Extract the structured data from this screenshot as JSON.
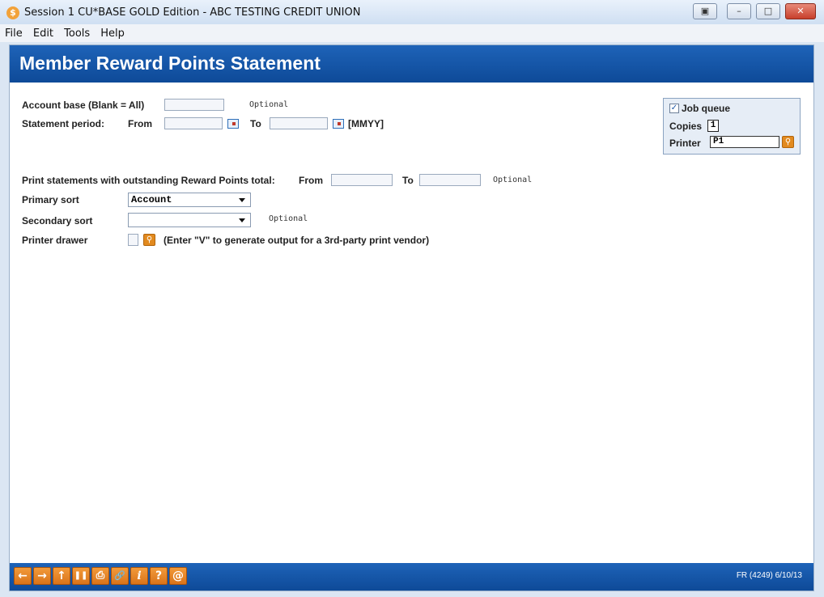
{
  "window": {
    "title": "Session 1 CU*BASE GOLD Edition - ABC TESTING CREDIT UNION",
    "buttons": [
      "restore",
      "minimize",
      "maximize",
      "close"
    ]
  },
  "menu": [
    "File",
    "Edit",
    "Tools",
    "Help"
  ],
  "header": {
    "title": "Member Reward Points Statement"
  },
  "form": {
    "account_base_label": "Account base (Blank = All)",
    "account_base_value": "",
    "account_base_hint": "Optional",
    "statement_period_label": "Statement period:",
    "from_label": "From",
    "from_value": "",
    "to_label": "To",
    "to_value": "",
    "date_format": "[MMYY]",
    "outstanding_label": "Print statements with outstanding Reward Points total:",
    "outstanding_from_label": "From",
    "outstanding_from_value": "",
    "outstanding_to_label": "To",
    "outstanding_to_value": "",
    "outstanding_hint": "Optional",
    "primary_sort_label": "Primary sort",
    "primary_sort_value": "Account",
    "secondary_sort_label": "Secondary sort",
    "secondary_sort_value": "",
    "secondary_sort_hint": "Optional",
    "printer_drawer_label": "Printer drawer",
    "printer_drawer_value": "",
    "printer_drawer_note": "(Enter \"V\" to generate output for a 3rd-party print vendor)"
  },
  "job": {
    "job_queue_label": "Job queue",
    "job_queue_checked": true,
    "copies_label": "Copies",
    "copies_value": "1",
    "printer_label": "Printer",
    "printer_value": "P1"
  },
  "toolbar": {
    "icons": [
      "back-arrow-icon",
      "forward-arrow-icon",
      "up-arrow-icon",
      "pause-icon",
      "print-icon",
      "link-icon",
      "info-icon",
      "help-icon",
      "email-icon"
    ],
    "glyphs": [
      "←",
      "→",
      "↑",
      "❚❚",
      "⎙",
      "🔗",
      "i",
      "?",
      "@"
    ],
    "footer_code": "FR (4249) 6/10/13"
  },
  "colors": {
    "header_blue": "#1459ad",
    "accent_orange": "#e28a1f"
  }
}
